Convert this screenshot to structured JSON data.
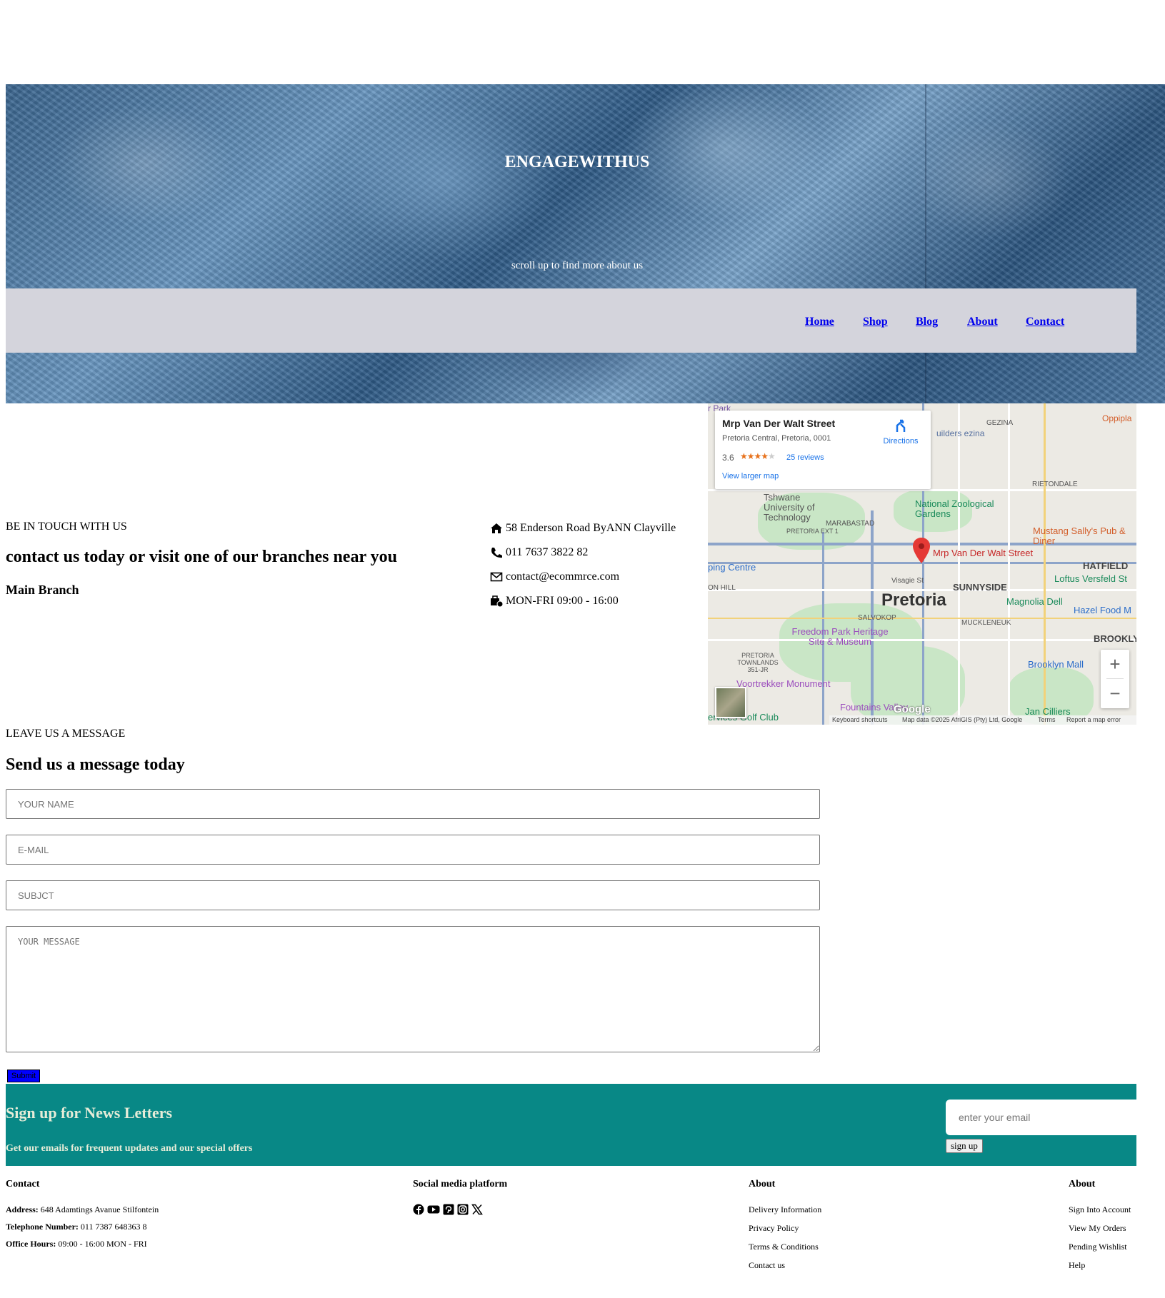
{
  "hero": {
    "title": "ENGAGEWITHUS",
    "subtitle": "scroll up to find more about us"
  },
  "nav": {
    "items": [
      "Home",
      "Shop",
      "Blog",
      "About",
      "Contact"
    ]
  },
  "contact": {
    "kicker": "BE IN TOUCH WITH US",
    "heading": "contact us today or visit one of our branches near you",
    "branch": "Main Branch",
    "address": "58 Enderson Road ByANN Clayville",
    "phone": "011 7637 3822 82",
    "email": "contact@ecommrce.com",
    "hours": "MON-FRI 09:00 - 16:00"
  },
  "map": {
    "place_name": "Mrp Van Der Walt Street",
    "place_address": "Pretoria Central, Pretoria, 0001",
    "rating": "3.6",
    "reviews": "25 reviews",
    "directions": "Directions",
    "larger_map": "View larger map",
    "pin_label": "Mrp Van Der Walt Street",
    "city": "Pretoria",
    "labels": {
      "gezina": "GEZINA",
      "oppipla": "Oppipla",
      "tut": "Tshwane University of Technology",
      "zoo": "National Zoological Gardens",
      "mustang": "Mustang Sally's Pub & Diner",
      "hatfield": "HATFIELD",
      "loftus": "Loftus Versfeld St",
      "sunnyside": "SUNNYSIDE",
      "magnolia": "Magnolia Dell",
      "hazel": "Hazel Food M",
      "muckleneuk": "MUCKLENEUK",
      "brooklyn": "BROOKLY",
      "brooklyn_mall": "Brooklyn Mall",
      "freedom": "Freedom Park Heritage Site & Museum",
      "salvokop": "SALVOKOP",
      "townlands": "PRETORIA TOWNLANDS 351-JR",
      "voortrekker": "Voortrekker Monument",
      "fountains": "Fountains Valley",
      "jan_cilliers": "Jan Cilliers",
      "golf": "ervices Golf Club",
      "shopping": "ping Centre",
      "marabastad": "MARABASTAD",
      "pretoria_ext": "PRETORIA EXT 1",
      "rietondale": "RIETONDALE",
      "visagie": "Visagie St",
      "builders": "uilders ezina",
      "park": "r Park",
      "hill": "ON HILL"
    },
    "footer": {
      "shortcuts": "Keyboard shortcuts",
      "attribution": "Map data ©2025 AfriGIS (Pty) Ltd, Google",
      "terms": "Terms",
      "report": "Report a map error",
      "logo": "Google"
    },
    "zoom_in": "+",
    "zoom_out": "−"
  },
  "message": {
    "kicker": "LEAVE US A MESSAGE",
    "heading": "Send us a message today",
    "name_placeholder": "YOUR NAME",
    "email_placeholder": "E-MAIL",
    "subject_placeholder": "SUBJCT",
    "message_placeholder": "YOUR MESSAGE",
    "submit": "Submit"
  },
  "newsletter": {
    "title": "Sign up for News Letters",
    "subtitle": "Get our emails for frequent updates and our special offers",
    "placeholder": "enter your email",
    "button": "sign up"
  },
  "footer": {
    "contact": {
      "heading": "Contact",
      "address_label": "Address:",
      "address": "648 Adamtings Avanue Stilfontein",
      "phone_label": "Telephone Number:",
      "phone": "011 7387 648363 8",
      "hours_label": "Office Hours:",
      "hours": "09:00 - 16:00 MON - FRI"
    },
    "social": {
      "heading": "Social media platform",
      "icons": [
        "facebook-icon",
        "youtube-icon",
        "pinterest-icon",
        "instagram-icon",
        "x-icon"
      ]
    },
    "about1": {
      "heading": "About",
      "links": [
        "Delivery Information",
        "Privacy Policy",
        "Terms & Conditions",
        "Contact us"
      ]
    },
    "about2": {
      "heading": "About",
      "links": [
        "Sign Into Account",
        "View My Orders",
        "Pending Wishlist",
        "Help"
      ]
    }
  }
}
